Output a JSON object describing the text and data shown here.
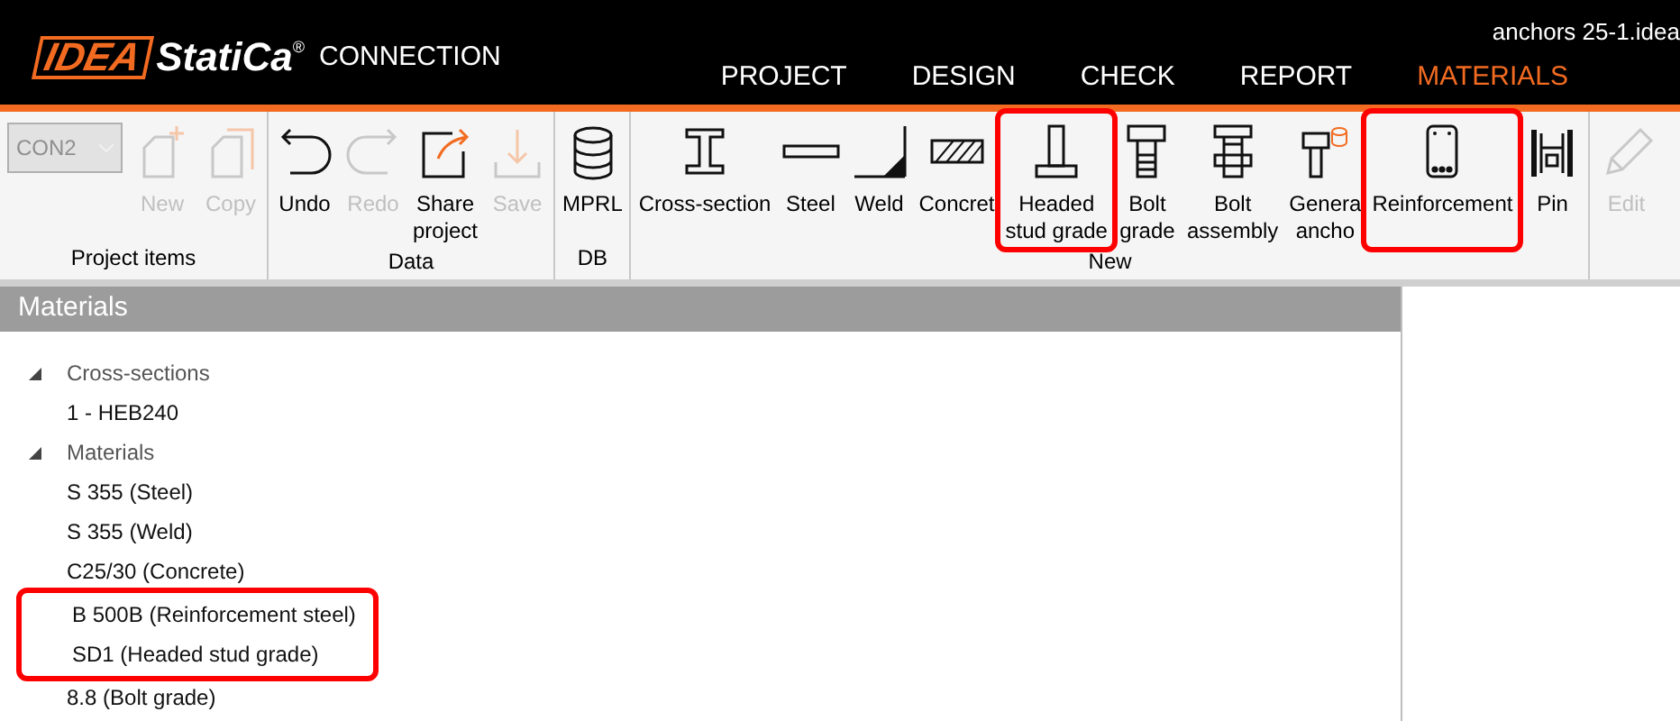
{
  "window": {
    "title": "anchors 25-1.idea"
  },
  "app": {
    "brand_a": "IDEA",
    "brand_b": "StatiCa",
    "brand_mark": "®",
    "product": "CONNECTION"
  },
  "tabs": [
    {
      "label": "PROJECT",
      "selected": false
    },
    {
      "label": "DESIGN",
      "selected": false
    },
    {
      "label": "CHECK",
      "selected": false
    },
    {
      "label": "REPORT",
      "selected": false
    },
    {
      "label": "MATERIALS",
      "selected": true
    }
  ],
  "ribbon": [
    {
      "label": "Project items",
      "items": [
        {
          "kind": "dropdown",
          "lines": [
            "CON2"
          ],
          "disabled": true
        },
        {
          "kind": "new",
          "lines": [
            "New"
          ],
          "disabled": true,
          "highlighted": false
        },
        {
          "kind": "copy",
          "lines": [
            "Copy"
          ],
          "disabled": true,
          "highlighted": false
        }
      ]
    },
    {
      "label": "Data",
      "items": [
        {
          "kind": "undo",
          "lines": [
            "Undo"
          ],
          "disabled": false,
          "highlighted": false
        },
        {
          "kind": "redo",
          "lines": [
            "Redo"
          ],
          "disabled": true,
          "highlighted": false
        },
        {
          "kind": "share",
          "lines": [
            "Share",
            "project"
          ],
          "disabled": false,
          "highlighted": false
        },
        {
          "kind": "save",
          "lines": [
            "Save"
          ],
          "disabled": true,
          "highlighted": false
        }
      ]
    },
    {
      "label": "DB",
      "items": [
        {
          "kind": "database",
          "lines": [
            "MPRL"
          ],
          "disabled": false,
          "highlighted": false
        }
      ]
    },
    {
      "label": "New",
      "items": [
        {
          "kind": "cross-section",
          "lines": [
            "Cross-section"
          ],
          "disabled": false,
          "highlighted": false
        },
        {
          "kind": "steel",
          "lines": [
            "Steel"
          ],
          "disabled": false,
          "highlighted": false
        },
        {
          "kind": "weld",
          "lines": [
            "Weld"
          ],
          "disabled": false,
          "highlighted": false
        },
        {
          "kind": "concrete",
          "lines": [
            "Concret"
          ],
          "disabled": false,
          "highlighted": false
        },
        {
          "kind": "stud",
          "lines": [
            "Headed",
            "stud grade"
          ],
          "disabled": false,
          "highlighted": true
        },
        {
          "kind": "bolt",
          "lines": [
            "Bolt",
            "grade"
          ],
          "disabled": false,
          "highlighted": false
        },
        {
          "kind": "bolt-assembly",
          "lines": [
            "Bolt",
            "assembly"
          ],
          "disabled": false,
          "highlighted": false
        },
        {
          "kind": "anchor",
          "lines": [
            "Genera",
            "ancho"
          ],
          "disabled": false,
          "highlighted": false
        },
        {
          "kind": "reinforcement",
          "lines": [
            "Reinforcement"
          ],
          "disabled": false,
          "highlighted": true
        },
        {
          "kind": "pin",
          "lines": [
            "Pin"
          ],
          "disabled": false,
          "highlighted": false
        }
      ]
    },
    {
      "items": [
        {
          "kind": "edit",
          "lines": [
            "Edit"
          ],
          "disabled": true,
          "highlighted": false
        }
      ]
    }
  ],
  "panel": {
    "title": "Materials"
  },
  "tree": [
    {
      "label": "Cross-sections",
      "expanded": true,
      "children": [
        {
          "label": "1 - HEB240",
          "highlighted": false
        }
      ]
    },
    {
      "label": "Materials",
      "expanded": true,
      "children": [
        {
          "label": "S 355 (Steel)",
          "highlighted": false
        },
        {
          "label": "S 355 (Weld)",
          "highlighted": false
        },
        {
          "label": "C25/30 (Concrete)",
          "highlighted": false
        },
        {
          "label": "B 500B (Reinforcement steel)",
          "highlighted": true
        },
        {
          "label": "SD1 (Headed stud grade)",
          "highlighted": true
        },
        {
          "label": "8.8 (Bolt grade)",
          "highlighted": false
        }
      ]
    }
  ]
}
